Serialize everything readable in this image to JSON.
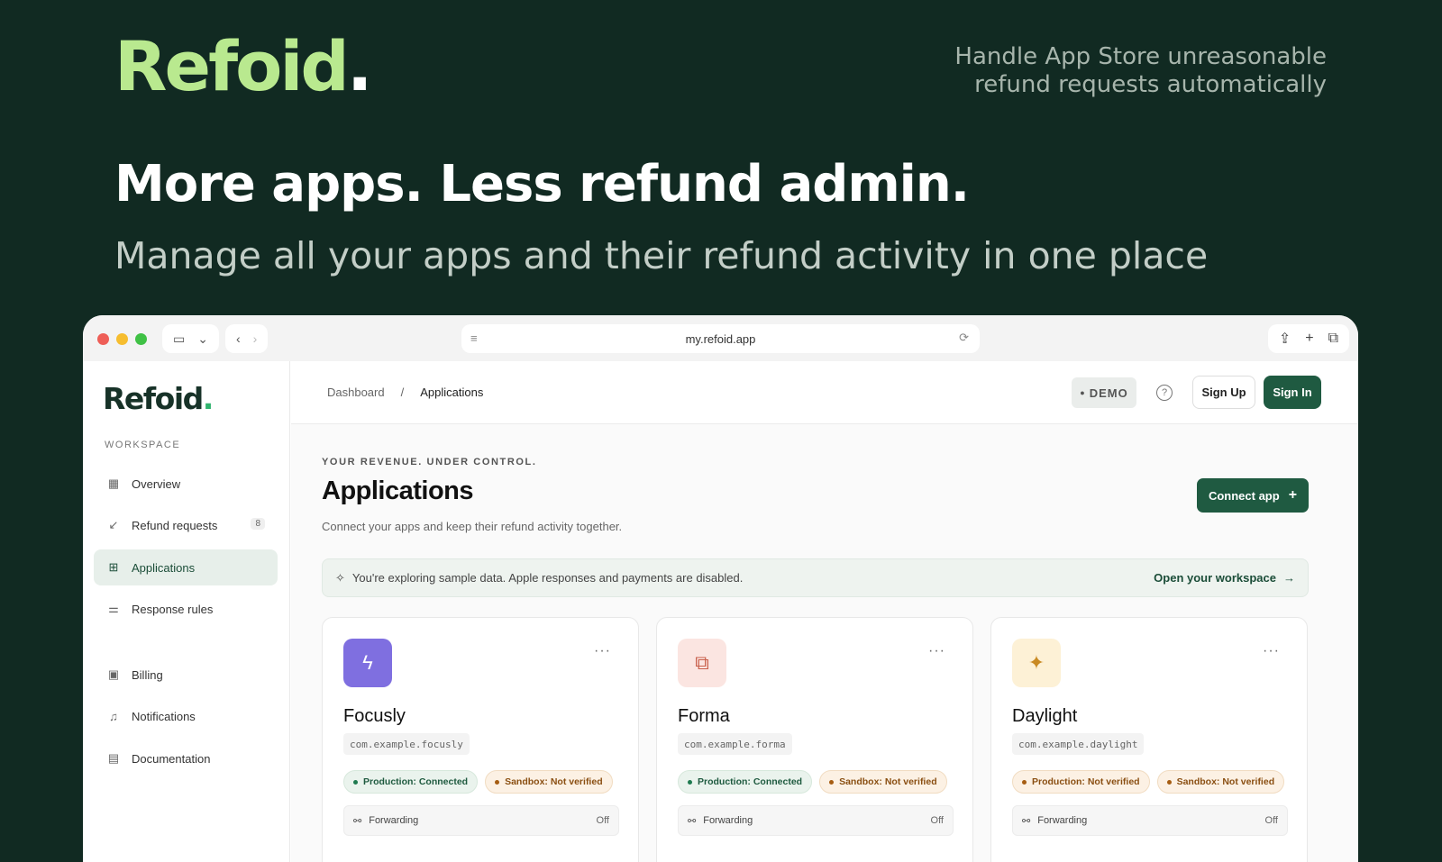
{
  "hero": {
    "logo": "Refoid",
    "logo_dot": ".",
    "tagline_line1": "Handle App Store unreasonable",
    "tagline_line2": "refund requests automatically",
    "headline": "More apps. Less refund admin.",
    "subhead": "Manage all your apps and their refund activity in one place"
  },
  "browser": {
    "url": "my.refoid.app",
    "traffic_lights": [
      "#ee5e57",
      "#f6bd2f",
      "#3fc145"
    ]
  },
  "sidebar": {
    "logo": "Refoid",
    "logo_dot": ".",
    "section_label": "WORKSPACE",
    "items": [
      {
        "label": "Overview",
        "icon": "grid-icon"
      },
      {
        "label": "Refund requests",
        "icon": "arrow-down-left-icon",
        "badge": "8"
      },
      {
        "label": "Applications",
        "icon": "apps-icon",
        "active": true
      },
      {
        "label": "Response rules",
        "icon": "sliders-icon"
      },
      {
        "label": "Billing",
        "icon": "wallet-icon"
      },
      {
        "label": "Notifications",
        "icon": "bell-icon"
      },
      {
        "label": "Documentation",
        "icon": "document-icon"
      }
    ]
  },
  "topbar": {
    "breadcrumb_root": "Dashboard",
    "breadcrumb_sep": "/",
    "breadcrumb_current": "Applications",
    "demo_label": "DEMO",
    "signup_label": "Sign Up",
    "signin_label": "Sign In"
  },
  "page": {
    "eyebrow": "YOUR REVENUE. UNDER CONTROL.",
    "title": "Applications",
    "description": "Connect your apps and keep their refund activity together.",
    "connect_label": "Connect app",
    "notice_text": "You're exploring sample data. Apple responses and payments are disabled.",
    "notice_link": "Open your workspace"
  },
  "apps": [
    {
      "name": "Focusly",
      "bundle": "com.example.focusly",
      "icon": "bolt-icon",
      "icon_bg": "#7f6fe0",
      "icon_color": "#ffffff",
      "production": "Production: Connected",
      "production_state": "ok",
      "sandbox": "Sandbox: Not verified",
      "sandbox_state": "warn",
      "forwarding": "Forwarding",
      "forwarding_state": "Off"
    },
    {
      "name": "Forma",
      "bundle": "com.example.forma",
      "icon": "shapes-icon",
      "icon_bg": "#fbe5e1",
      "icon_color": "#c9604c",
      "production": "Production: Connected",
      "production_state": "ok",
      "sandbox": "Sandbox: Not verified",
      "sandbox_state": "warn",
      "forwarding": "Forwarding",
      "forwarding_state": "Off"
    },
    {
      "name": "Daylight",
      "bundle": "com.example.daylight",
      "icon": "sparkle-icon",
      "icon_bg": "#fdf1d6",
      "icon_color": "#c98a23",
      "production": "Production: Not verified",
      "production_state": "warn",
      "sandbox": "Sandbox: Not verified",
      "sandbox_state": "warn",
      "forwarding": "Forwarding",
      "forwarding_state": "Off"
    }
  ]
}
